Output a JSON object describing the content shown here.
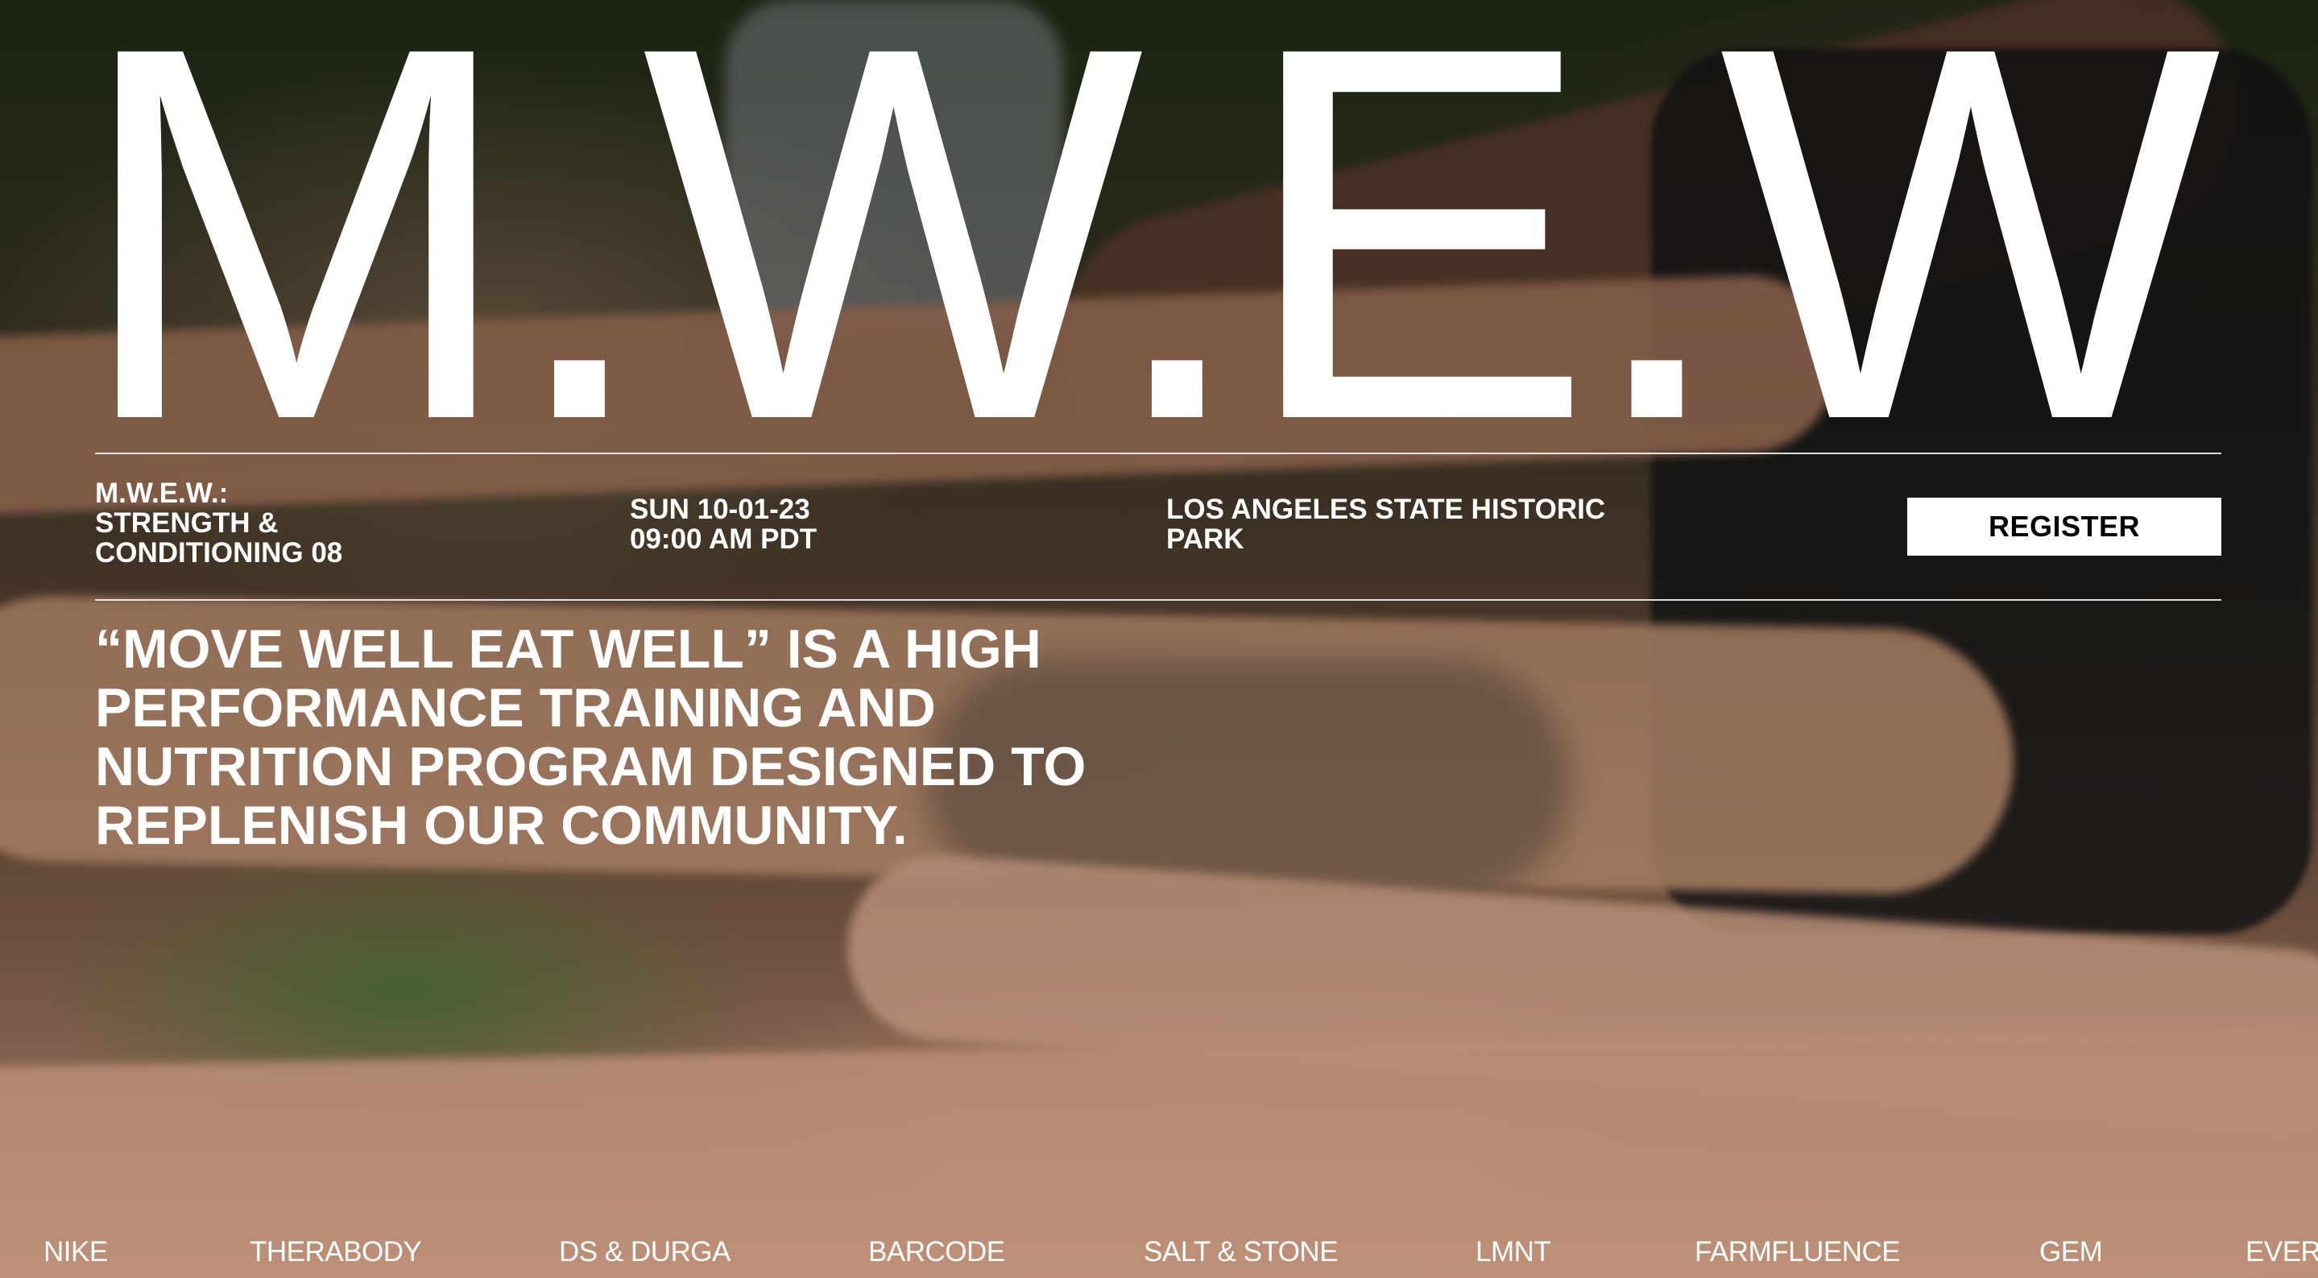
{
  "hero": {
    "title": "M.W.E.W"
  },
  "event": {
    "program_lines": [
      "M.W.E.W.:",
      "STRENGTH &",
      "CONDITIONING 08"
    ],
    "date_lines": [
      "SUN 10-01-23",
      "09:00 AM PDT"
    ],
    "location_lines": [
      "LOS ANGELES STATE HISTORIC",
      "PARK"
    ],
    "register_label": "REGISTER"
  },
  "tagline": "“MOVE WELL EAT WELL” IS A HIGH PERFORMANCE TRAINING AND NUTRITION PROGRAM DESIGNED TO REPLENISH OUR COMMUNITY.",
  "sponsors": [
    "NIKE",
    "THERABODY",
    "DS & DURGA",
    "BARCODE",
    "SALT & STONE",
    "LMNT",
    "FARMFLUENCE",
    "GEM",
    "EVERY"
  ],
  "colors": {
    "text": "#ffffff",
    "button_bg": "#ffffff",
    "button_text": "#000000"
  }
}
